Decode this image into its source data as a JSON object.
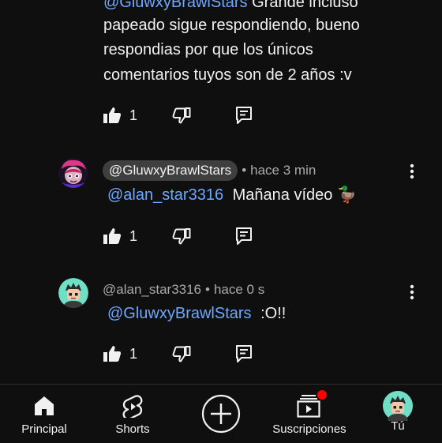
{
  "comments": [
    {
      "first_line_mention": "@GluwxyBrawlStars",
      "first_line_rest": " Grande incluso",
      "lines": [
        "papeado sigue respondiendo, bueno",
        "respondias por que los únicos",
        "comentarios tuyos son de 2 años :v"
      ],
      "likes": "1"
    },
    {
      "author": "@GluwxyBrawlStars",
      "time": "hace 3 min",
      "mention": "@alan_star3316",
      "text": "Mañana vídeo 🦆",
      "likes": "1"
    },
    {
      "author": "@alan_star3316",
      "time": "hace 0 s",
      "mention": "@GluwxyBrawlStars",
      "text": ":O!!",
      "likes": "1"
    }
  ],
  "separator": "•",
  "nav": {
    "home": "Principal",
    "shorts": "Shorts",
    "subscriptions": "Suscripciones",
    "you": "Tú"
  },
  "colors": {
    "background": "#0f0f0f",
    "mention": "#6ea8fe",
    "chip": "#3f3f3f",
    "notification": "#ff0000"
  },
  "icons": [
    "like-icon",
    "dislike-icon",
    "reply-icon",
    "more-icon",
    "home-icon",
    "shorts-icon",
    "create-icon",
    "subscriptions-icon"
  ]
}
